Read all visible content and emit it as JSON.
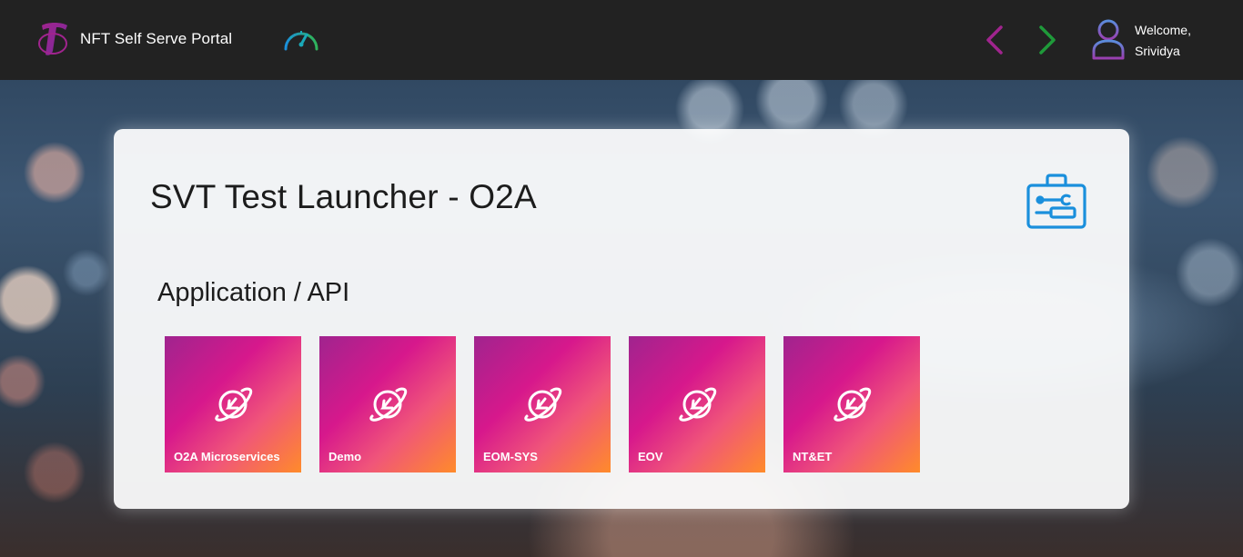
{
  "header": {
    "app_title": "NFT Self Serve Portal",
    "logo_icon": "telstra-t-logo-icon",
    "dashboard_icon": "speedometer-gauge-icon",
    "back_icon": "chevron-left-icon",
    "forward_icon": "chevron-right-icon",
    "user_icon": "user-avatar-icon",
    "welcome_line1": "Welcome,",
    "welcome_line2": "Srividya"
  },
  "card": {
    "title": "SVT Test Launcher - O2A",
    "toolkit_icon": "toolbox-settings-icon",
    "section_title": "Application / API",
    "tiles": [
      {
        "label": "O2A Microservices",
        "icon": "api-planet-icon"
      },
      {
        "label": "Demo",
        "icon": "api-planet-icon"
      },
      {
        "label": "EOM-SYS",
        "icon": "api-planet-icon"
      },
      {
        "label": "EOV",
        "icon": "api-planet-icon"
      },
      {
        "label": "NT&ET",
        "icon": "api-planet-icon"
      }
    ]
  },
  "colors": {
    "topbar": "#222222",
    "tile_gradient_start": "#a0248e",
    "tile_gradient_mid": "#d7188c",
    "tile_gradient_end": "#ff8b2a",
    "back_chevron": "#a0248e",
    "forward_chevron": "#1f9a3a",
    "toolkit_blue": "#1a8fdc"
  }
}
